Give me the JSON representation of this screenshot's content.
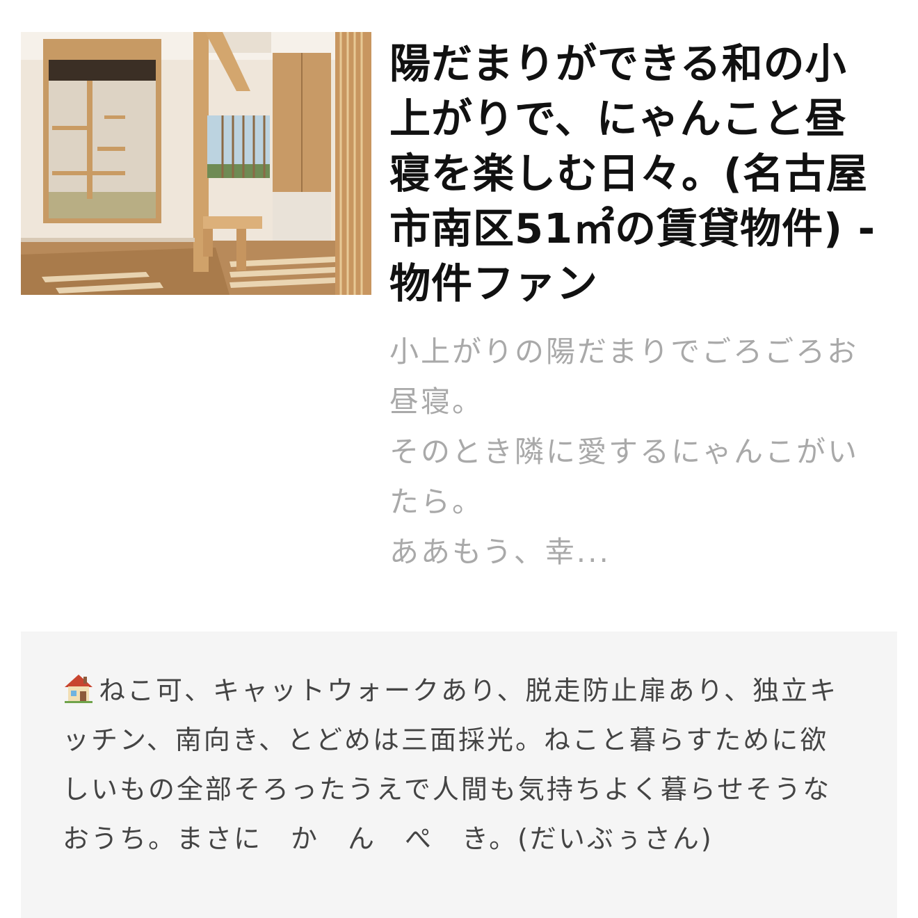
{
  "card": {
    "title": "陽だまりができる和の小上がりで、にゃんこと昼寝を楽しむ日々。(名古屋市南区51㎡の賃貸物件) - 物件ファン",
    "description": "小上がりの陽だまりでごろごろお昼寝。\nそのとき隣に愛するにゃんこがいたら。\nああもう、幸...",
    "thumbnail_icon": "room-photo"
  },
  "comment": {
    "icon": "house-icon",
    "text": "ねこ可、キャットウォークあり、脱走防止扉あり、独立キッチン、南向き、とどめは三面採光。ねこと暮らすために欲しいもの全部そろったうえで人間も気持ちよく暮らせそうなおうち。まさに　か　ん　ぺ　き。(だいぶぅさん)"
  },
  "colors": {
    "title": "#111111",
    "description": "#a9a9a9",
    "comment_bg": "#f5f5f5",
    "comment_text": "#444444"
  }
}
